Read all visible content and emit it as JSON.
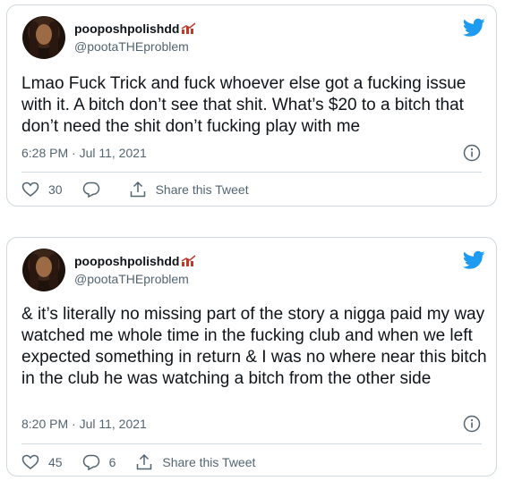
{
  "tweets": [
    {
      "display_name": "pooposhpolishdd",
      "handle": "@pootaTHEproblem",
      "text": "Lmao Fuck Trick and fuck whoever else got a fucking issue with it. A bitch don’t see that shit. What’s $20 to a bitch that don’t need the shit don’t fucking play with me",
      "timestamp": "6:28 PM · Jul 11, 2021",
      "likes": "30",
      "replies": "",
      "share_label": "Share this Tweet"
    },
    {
      "display_name": "pooposhpolishdd",
      "handle": "@pootaTHEproblem",
      "text": "& it’s literally no missing part of the story a nigga paid my way watched me whole time in the fucking club and when we left expected something in return & I was no where near this bitch in the club he was watching a bitch from the other side",
      "timestamp": "8:20 PM · Jul 11, 2021",
      "likes": "45",
      "replies": "6",
      "share_label": "Share this Tweet"
    }
  ],
  "colors": {
    "twitter_blue": "#1d9bf0",
    "secondary_text": "#536471",
    "border": "#cfd9de"
  },
  "icons": [
    "twitter-bird-icon",
    "info-icon",
    "heart-icon",
    "reply-icon",
    "share-icon",
    "nail-polish-emoji",
    "chart-emoji"
  ]
}
